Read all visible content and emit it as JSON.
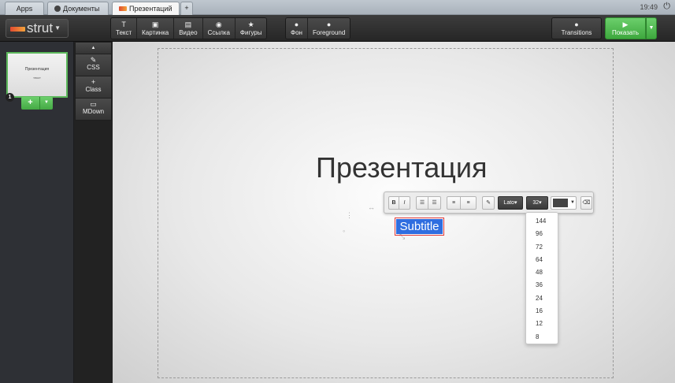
{
  "browser": {
    "tabs": [
      {
        "label": "Apps"
      },
      {
        "label": "Документы"
      },
      {
        "label": "Презентаций"
      },
      {
        "label": "+"
      }
    ],
    "clock": "19:49"
  },
  "header": {
    "logo": "strut",
    "tools": [
      {
        "icon": "text-icon",
        "label": "Текст"
      },
      {
        "icon": "image-icon",
        "label": "Картинка"
      },
      {
        "icon": "video-icon",
        "label": "Видео"
      },
      {
        "icon": "link-icon",
        "label": "Ссылка"
      },
      {
        "icon": "star-icon",
        "label": "Фигуры"
      }
    ],
    "bg_tools": [
      {
        "icon": "drop-icon",
        "label": "Фон"
      },
      {
        "icon": "drop-icon",
        "label": "Foreground"
      }
    ],
    "transitions_label": "Transitions",
    "show_label": "Показать",
    "accent_color": "#4cae4c"
  },
  "well": {
    "thumb_title": "Презентация",
    "thumb_subtitle": "текст",
    "slide_number": "1"
  },
  "minibar": {
    "css_label": "CSS",
    "class_label": "Class",
    "markdown_label": "MDown"
  },
  "slide": {
    "title": "Презентация",
    "subtitle": "Subtitle",
    "selection_color": "#2f6ee0"
  },
  "text_toolbar": {
    "bold": "B",
    "italic": "I",
    "font": "Lato",
    "size": "32",
    "text_color": "#444444"
  },
  "size_options": [
    "144",
    "96",
    "72",
    "64",
    "48",
    "36",
    "24",
    "16",
    "12",
    "8"
  ]
}
